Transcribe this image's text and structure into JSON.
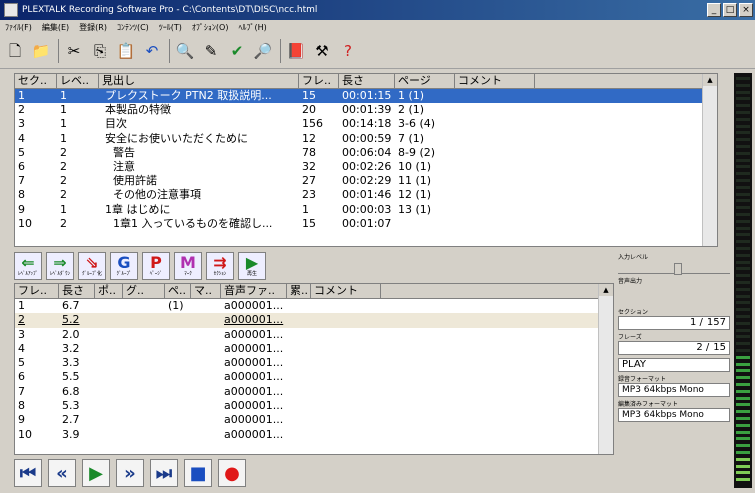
{
  "window": {
    "title": "PLEXTALK Recording Software Pro - C:\\Contents\\DT\\DISC\\ncc.html"
  },
  "menu": [
    "ﾌｧｲﾙ(F)",
    "編集(E)",
    "登録(R)",
    "ｺﾝﾃﾝﾂ(C)",
    "ﾂｰﾙ(T)",
    "ｵﾌﾟｼｮﾝ(O)",
    "ﾍﾙﾌﾟ(H)"
  ],
  "toolbar_icons": [
    "new-file-icon",
    "open-folder-icon",
    "cut-icon",
    "copy-icon",
    "paste-icon",
    "undo-icon",
    "find-icon",
    "edit-icon",
    "check-icon",
    "zoom-icon",
    "book-icon",
    "tools-icon",
    "help-icon"
  ],
  "sections": {
    "columns": [
      "セク..",
      "レベ..",
      "見出し",
      "フレ..",
      "長さ",
      "ページ",
      "コメント"
    ],
    "rows": [
      [
        "1",
        "1",
        "プレクストーク PTN2 取扱説明...",
        "15",
        "00:01:15",
        "1 (1)",
        ""
      ],
      [
        "2",
        "1",
        "本製品の特徴",
        "20",
        "00:01:39",
        "2 (1)",
        ""
      ],
      [
        "3",
        "1",
        "目次",
        "156",
        "00:14:18",
        "3-6 (4)",
        ""
      ],
      [
        "4",
        "1",
        "安全にお使いいただくために",
        "12",
        "00:00:59",
        "7 (1)",
        ""
      ],
      [
        "5",
        "2",
        "警告",
        "78",
        "00:06:04",
        "8-9 (2)",
        ""
      ],
      [
        "6",
        "2",
        "注意",
        "32",
        "00:02:26",
        "10 (1)",
        ""
      ],
      [
        "7",
        "2",
        "使用許諾",
        "27",
        "00:02:29",
        "11 (1)",
        ""
      ],
      [
        "8",
        "2",
        "その他の注意事項",
        "23",
        "00:01:46",
        "12 (1)",
        ""
      ],
      [
        "9",
        "1",
        "1章 はじめに",
        "1",
        "00:00:03",
        "13 (1)",
        ""
      ],
      [
        "10",
        "2",
        "1章1 入っているものを確認し...",
        "15",
        "00:01:07",
        "",
        ""
      ]
    ]
  },
  "edit_buttons": [
    {
      "sym": "⇐",
      "label": "ﾚﾍﾞﾙｱｯﾌﾟ",
      "color": "#1a8a2a"
    },
    {
      "sym": "⇒",
      "label": "ﾚﾍﾞﾙﾀﾞｳﾝ",
      "color": "#1a8a2a"
    },
    {
      "sym": "⇘",
      "label": "ｸﾞﾙｰﾌﾟ化",
      "color": "#d01818"
    },
    {
      "sym": "G",
      "label": "ｸﾞﾙｰﾌﾟ",
      "color": "#1a4ec0"
    },
    {
      "sym": "P",
      "label": "ﾍﾟｰｼﾞ",
      "color": "#d01818"
    },
    {
      "sym": "M",
      "label": "ﾏｰｸ",
      "color": "#b030b0"
    },
    {
      "sym": "⇉",
      "label": "ｾｸｼｮﾝ",
      "color": "#d01818"
    },
    {
      "sym": "▶",
      "label": "再生",
      "color": "#1a8a2a"
    }
  ],
  "phrases": {
    "columns": [
      "フレ..",
      "長さ",
      "ポ..",
      "グ..",
      "ペ..",
      "マ..",
      "音声ファ..",
      "累..",
      "コメント"
    ],
    "rows": [
      [
        "1",
        "6.7",
        "",
        "",
        "(1)",
        "",
        "a000001...",
        "",
        ""
      ],
      [
        "2",
        "5.2",
        "",
        "",
        "",
        "",
        "a000001...",
        "",
        ""
      ],
      [
        "3",
        "2.0",
        "",
        "",
        "",
        "",
        "a000001...",
        "",
        ""
      ],
      [
        "4",
        "3.2",
        "",
        "",
        "",
        "",
        "a000001...",
        "",
        ""
      ],
      [
        "5",
        "3.3",
        "",
        "",
        "",
        "",
        "a000001...",
        "",
        ""
      ],
      [
        "6",
        "5.5",
        "",
        "",
        "",
        "",
        "a000001...",
        "",
        ""
      ],
      [
        "7",
        "6.8",
        "",
        "",
        "",
        "",
        "a000001...",
        "",
        ""
      ],
      [
        "8",
        "5.3",
        "",
        "",
        "",
        "",
        "a000001...",
        "",
        ""
      ],
      [
        "9",
        "2.7",
        "",
        "",
        "",
        "",
        "a000001...",
        "",
        ""
      ],
      [
        "10",
        "3.9",
        "",
        "",
        "",
        "",
        "a000001...",
        "",
        ""
      ]
    ]
  },
  "info": {
    "input_level_label": "入力レベル",
    "output_label": "音声出力",
    "section_label": "セクション",
    "section_current": "1 /",
    "section_total": "157",
    "phrase_label": "フレーズ",
    "phrase_current": "2 /",
    "phrase_total": "15",
    "status": "PLAY",
    "rec_format_label": "録音フォーマット",
    "rec_format": "MP3 64kbps Mono",
    "edit_format_label": "編集済みフォーマット",
    "edit_format": "MP3 64kbps Mono"
  },
  "transport": [
    {
      "name": "skip-to-start-button",
      "sym": "⏮",
      "color": "#1a3a8a"
    },
    {
      "name": "rewind-button",
      "sym": "«",
      "color": "#1a3a8a"
    },
    {
      "name": "play-button",
      "sym": "▶",
      "color": "#1a8a2a"
    },
    {
      "name": "fast-forward-button",
      "sym": "»",
      "color": "#1a3a8a"
    },
    {
      "name": "skip-to-end-button",
      "sym": "⏭",
      "color": "#1a3a8a"
    },
    {
      "name": "stop-button",
      "sym": "■",
      "color": "#1a4ec0"
    },
    {
      "name": "record-button",
      "sym": "●",
      "color": "#e01818"
    }
  ],
  "colors": {
    "selection": "#316ac5",
    "meter_green": "#3aa040"
  }
}
